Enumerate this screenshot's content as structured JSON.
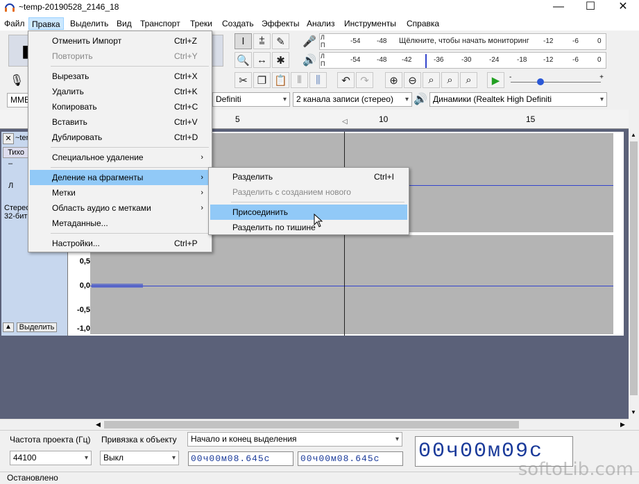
{
  "window": {
    "title": "~temp-20190528_2146_18",
    "minimize": "—",
    "maximize": "☐",
    "close": "✕"
  },
  "menubar": [
    {
      "label": "Файл"
    },
    {
      "label": "Правка"
    },
    {
      "label": "Выделить"
    },
    {
      "label": "Вид"
    },
    {
      "label": "Транспорт"
    },
    {
      "label": "Треки"
    },
    {
      "label": "Создать"
    },
    {
      "label": "Эффекты"
    },
    {
      "label": "Анализ"
    },
    {
      "label": "Инструменты"
    },
    {
      "label": "Справка"
    }
  ],
  "edit_menu": {
    "items": [
      {
        "label": "Отменить Импорт",
        "shortcut": "Ctrl+Z"
      },
      {
        "label": "Повторить",
        "shortcut": "Ctrl+Y"
      },
      {
        "label": "Вырезать",
        "shortcut": "Ctrl+X"
      },
      {
        "label": "Удалить",
        "shortcut": "Ctrl+K"
      },
      {
        "label": "Копировать",
        "shortcut": "Ctrl+C"
      },
      {
        "label": "Вставить",
        "shortcut": "Ctrl+V"
      },
      {
        "label": "Дублировать",
        "shortcut": "Ctrl+D"
      },
      {
        "label": "Специальное удаление",
        "arrow": "›"
      },
      {
        "label": "Деление на фрагменты",
        "arrow": "›"
      },
      {
        "label": "Метки",
        "arrow": "›"
      },
      {
        "label": "Область аудио с метками",
        "arrow": "›"
      },
      {
        "label": "Метаданные..."
      },
      {
        "label": "Настройки...",
        "shortcut": "Ctrl+P"
      }
    ]
  },
  "submenu": {
    "items": [
      {
        "label": "Разделить",
        "shortcut": "Ctrl+I"
      },
      {
        "label": "Разделить с созданием нового"
      },
      {
        "label": "Присоединить"
      },
      {
        "label": "Разделить по тишине"
      }
    ]
  },
  "meters": {
    "record_ticks": [
      "-54",
      "-48",
      "Щёлкните, чтобы начать мониторинг",
      "-12",
      "-6",
      "0"
    ],
    "play_ticks": [
      "-54",
      "-48",
      "-42",
      "-36",
      "-30",
      "-24",
      "-18",
      "-12",
      "-6",
      "0"
    ],
    "channel_l": "Л",
    "channel_r": "П"
  },
  "device": {
    "host": "MME",
    "input": "Definiti",
    "channels": "2 канала записи (стерео)",
    "output": "Динамики (Realtek High Definiti"
  },
  "ruler": {
    "labels": [
      "5",
      "10",
      "15"
    ]
  },
  "track": {
    "name": "~tem",
    "mute_label": "Тихо",
    "gain_minus": "–",
    "pan_left": "Л",
    "info_line1": "Стерео",
    "info_line2": "32-бит",
    "select_button": "Выделить",
    "scale": [
      "0,5",
      "0,0",
      "-0,5",
      "-1,0"
    ]
  },
  "selection_bar": {
    "rate_label": "Частота проекта (Гц)",
    "rate_value": "44100",
    "snap_label": "Привязка к объекту",
    "snap_value": "Выкл",
    "sel_mode": "Начало и конец выделения",
    "start_time": "00ч00м08.645с",
    "end_time": "00ч00м08.645с",
    "big_time": "00ч00м09с"
  },
  "status": {
    "text": "Остановлено"
  },
  "watermark": "softoLib.com"
}
